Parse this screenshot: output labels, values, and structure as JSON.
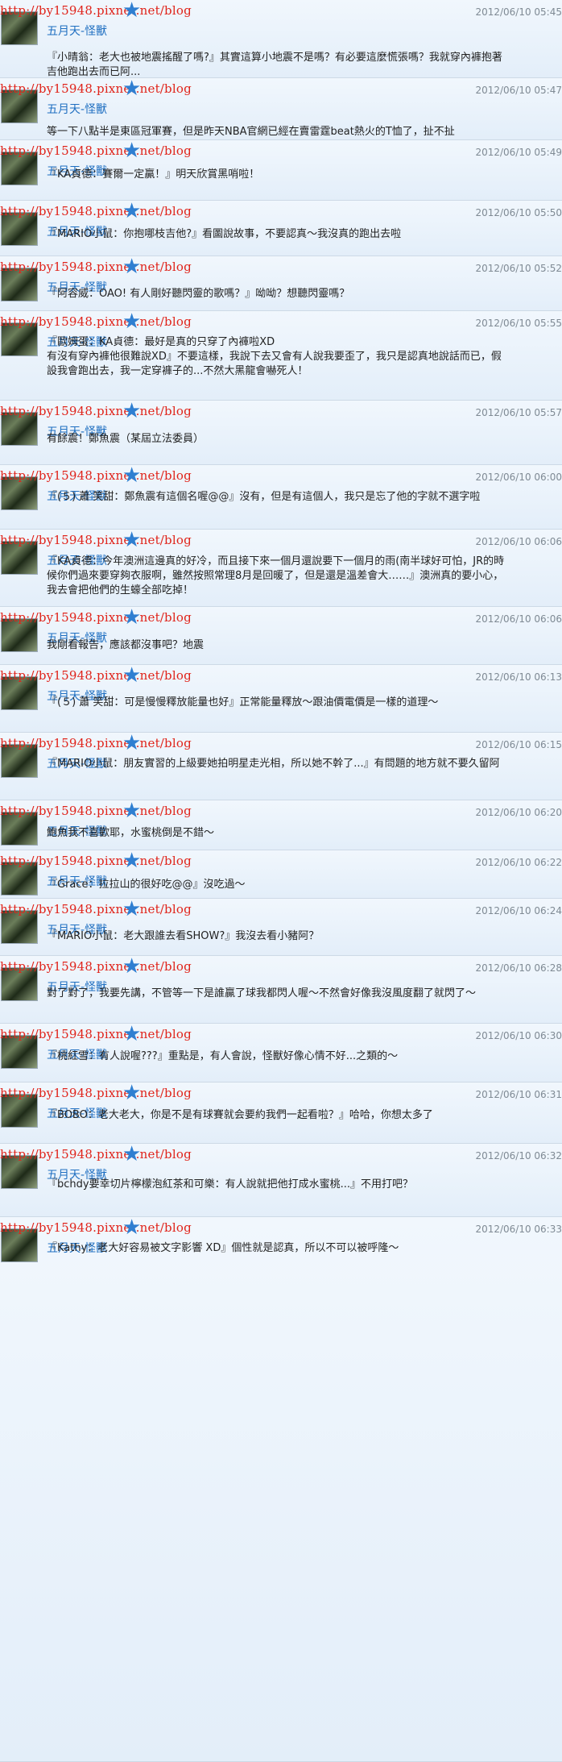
{
  "posts": [
    {
      "watermark": "http://by15948.pixnet.net/blog",
      "name": "五月天-怪獸",
      "time": "2012/06/10 05:45",
      "text": "『小晴翁：老大也被地震搖醒了嗎?』其實這算小地震不是嗎？有必要這麼慌張嗎？我就穿內褲抱著吉他跑出去而已阿..."
    },
    {
      "watermark": "http://by15948.pixnet.net/blog",
      "name": "五月天-怪獸",
      "time": "2012/06/10 05:47",
      "text": "等一下八點半是東區冠軍賽，但是昨天NBA官網已經在賣雷霆beat熱火的T恤了，扯不扯"
    },
    {
      "watermark": "http://by15948.pixnet.net/blog",
      "name": "五月天-怪獸",
      "time": "2012/06/10 05:49",
      "text": "『KA貞德：賽爾一定贏！』明天欣賞黑哨啦！"
    },
    {
      "watermark": "http://by15948.pixnet.net/blog",
      "name": "五月天-怪獸",
      "time": "2012/06/10 05:50",
      "text": "『MARIO小鼠：你抱哪枝吉他?』看圖說故事，不要認真～我沒真的跑出去啦"
    },
    {
      "watermark": "http://by15948.pixnet.net/blog",
      "name": "五月天-怪獸",
      "time": "2012/06/10 05:52",
      "text": "『阿容威：OAO! 有人剛好聽閃靈的歌嗎？』呦呦？想聽閃靈嗎？"
    },
    {
      "watermark": "http://by15948.pixnet.net/blog",
      "name": "五月天-怪獸",
      "time": "2012/06/10 05:55",
      "text": "『歐姆蛋：KA貞德：最好是真的只穿了內褲啦XD\n有沒有穿內褲他很難說XD』不要這樣，我說下去又會有人說我要歪了，我只是認真地說話而已，假設我會跑出去，我一定穿褲子的...不然大黑龍會嚇死人！"
    },
    {
      "watermark": "http://by15948.pixnet.net/blog",
      "name": "五月天-怪獸",
      "time": "2012/06/10 05:57",
      "text": "有餘震！鄭魚震（某屆立法委員）"
    },
    {
      "watermark": "http://by15948.pixnet.net/blog",
      "name": "五月天-怪獸",
      "time": "2012/06/10 06:00",
      "text": "『(５) 蕭 笑甜：鄭魚震有這個名喔@@』沒有，但是有這個人，我只是忘了他的字就不選字啦"
    },
    {
      "watermark": "http://by15948.pixnet.net/blog",
      "name": "五月天-怪獸",
      "time": "2012/06/10 06:06",
      "text": "『KA貞德：今年澳洲這邊真的好冷，而且接下來一個月還說要下一個月的雨(南半球好可怕，JR的時候你們過來要穿夠衣服啊，雖然按照常理8月是回暖了，但是還是溫差會大……』澳洲真的要小心，我去會把他們的生蠔全部吃掉！"
    },
    {
      "watermark": "http://by15948.pixnet.net/blog",
      "name": "五月天-怪獸",
      "time": "2012/06/10 06:06",
      "text": "我剛看報告，應該都沒事吧？地震"
    },
    {
      "watermark": "http://by15948.pixnet.net/blog",
      "name": "五月天-怪獸",
      "time": "2012/06/10 06:13",
      "text": "『(５) 蕭 笑甜：可是慢慢釋放能量也好』正常能量釋放～跟油價電價是一樣的道理～"
    },
    {
      "watermark": "http://by15948.pixnet.net/blog",
      "name": "五月天-怪獸",
      "time": "2012/06/10 06:15",
      "text": "『MARIO小鼠：朋友實習的上級要她拍明星走光相，所以她不幹了...』有問題的地方就不要久留阿"
    },
    {
      "watermark": "http://by15948.pixnet.net/blog",
      "name": "五月天-怪獸",
      "time": "2012/06/10 06:20",
      "text": "鮑魚我不喜歡耶，水蜜桃倒是不錯～"
    },
    {
      "watermark": "http://by15948.pixnet.net/blog",
      "name": "五月天-怪獸",
      "time": "2012/06/10 06:22",
      "text": "『Grace：拉拉山的很好吃@@』沒吃過～"
    },
    {
      "watermark": "http://by15948.pixnet.net/blog",
      "name": "五月天-怪獸",
      "time": "2012/06/10 06:24",
      "text": "『MARIO小鼠：老大跟誰去看SHOW?』我沒去看小豬阿？"
    },
    {
      "watermark": "http://by15948.pixnet.net/blog",
      "name": "五月天-怪獸",
      "time": "2012/06/10 06:28",
      "text": "對了對了，我要先講，不管等一下是誰贏了球我都閃人喔～不然會好像我沒風度翻了就閃了～"
    },
    {
      "watermark": "http://by15948.pixnet.net/blog",
      "name": "五月天-怪獸",
      "time": "2012/06/10 06:30",
      "text": "『桃紅雪：有人說喔???』重點是，有人會說，怪獸好像心情不好...之類的～"
    },
    {
      "watermark": "http://by15948.pixnet.net/blog",
      "name": "五月天-怪獸",
      "time": "2012/06/10 06:31",
      "text": "『BOBO：老大老大，你是不是有球賽就会要約我們一起看啦？』哈哈，你想太多了"
    },
    {
      "watermark": "http://by15948.pixnet.net/blog",
      "name": "五月天-怪獸",
      "time": "2012/06/10 06:32",
      "text": "『bchdy要幸切片檸檬泡紅茶和可樂：有人說就把他打成水蜜桃...』不用打吧？"
    },
    {
      "watermark": "http://by15948.pixnet.net/blog",
      "name": "五月天-怪獸",
      "time": "2012/06/10 06:33",
      "text": "『Kathy：老大好容易被文字影響 XD』個性就是認真，所以不可以被呼隆～"
    }
  ]
}
